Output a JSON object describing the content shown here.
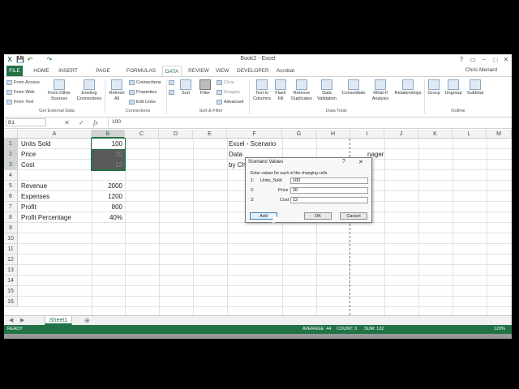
{
  "window": {
    "title": "Book2 - Excel",
    "help": "?",
    "ribbon_display": "▭",
    "minimize": "–",
    "maximize": "□",
    "close": "✕",
    "user": "Chris Menard"
  },
  "qat": {
    "save": "💾",
    "undo": "↶",
    "redo": "↷"
  },
  "tabs": [
    "FILE",
    "HOME",
    "INSERT",
    "PAGE LAYOUT",
    "FORMULAS",
    "DATA",
    "REVIEW",
    "VIEW",
    "DEVELOPER",
    "Acrobat"
  ],
  "ribbon": {
    "get_external": {
      "access": "From Access",
      "web": "From Web",
      "text": "From Text",
      "other": "From Other Sources",
      "existing": "Existing Connections",
      "group": "Get External Data"
    },
    "connections": {
      "refresh": "Refresh All",
      "connections": "Connections",
      "properties": "Properties",
      "edit_links": "Edit Links",
      "group": "Connections"
    },
    "sort_filter": {
      "sort": "Sort",
      "filter": "Filter",
      "clear": "Clear",
      "reapply": "Reapply",
      "advanced": "Advanced",
      "group": "Sort & Filter"
    },
    "data_tools": {
      "text_to_columns": "Text to Columns",
      "flash_fill": "Flash Fill",
      "remove_duplicates": "Remove Duplicates",
      "data_validation": "Data Validation",
      "consolidate": "Consolidate",
      "whatif": "What-If Analysis",
      "relationships": "Relationships",
      "group": "Data Tools"
    },
    "outline": {
      "group_btn": "Group",
      "ungroup": "Ungroup",
      "subtotal": "Subtotal",
      "group": "Outline"
    }
  },
  "formula_bar": {
    "name_box": "B1",
    "formula": "100"
  },
  "columns": [
    "A",
    "B",
    "C",
    "D",
    "E",
    "F",
    "G",
    "H",
    "I",
    "J",
    "K",
    "L",
    "M"
  ],
  "rows": [
    "1",
    "2",
    "3",
    "4",
    "5",
    "6",
    "7",
    "8",
    "9",
    "10",
    "11",
    "12",
    "13",
    "14",
    "15",
    "16"
  ],
  "cells": {
    "a1": "Units Sold",
    "b1": "100",
    "a2": "Price",
    "b2": "20",
    "a3": "Cost",
    "b3": "12",
    "a5": "Revenue",
    "b5": "2000",
    "a6": "Expenses",
    "b6": "1200",
    "a7": "Profit",
    "b7": "800",
    "a8": "Profit Percentage",
    "b8": "40%",
    "f1": "Excel - Scenario",
    "f2": "Data",
    "f3": "by Ch",
    "i2": "nager"
  },
  "sheet": {
    "name": "Sheet1",
    "add": "⊕"
  },
  "status": {
    "ready": "READY",
    "average": "AVERAGE: 44",
    "count": "COUNT: 3",
    "sum": "SUM: 132",
    "zoom": "120%"
  },
  "dialog": {
    "title": "Scenario Values",
    "help": "?",
    "close": "✕",
    "instruction": "Enter values for each of the changing cells.",
    "rows": [
      {
        "num": "1:",
        "label": "Units_Sold",
        "value": "100"
      },
      {
        "num": "2:",
        "label": "Price",
        "value": "20"
      },
      {
        "num": "3:",
        "label": "Cost",
        "value": "12"
      }
    ],
    "add": "Add",
    "ok": "OK",
    "cancel": "Cancel"
  }
}
